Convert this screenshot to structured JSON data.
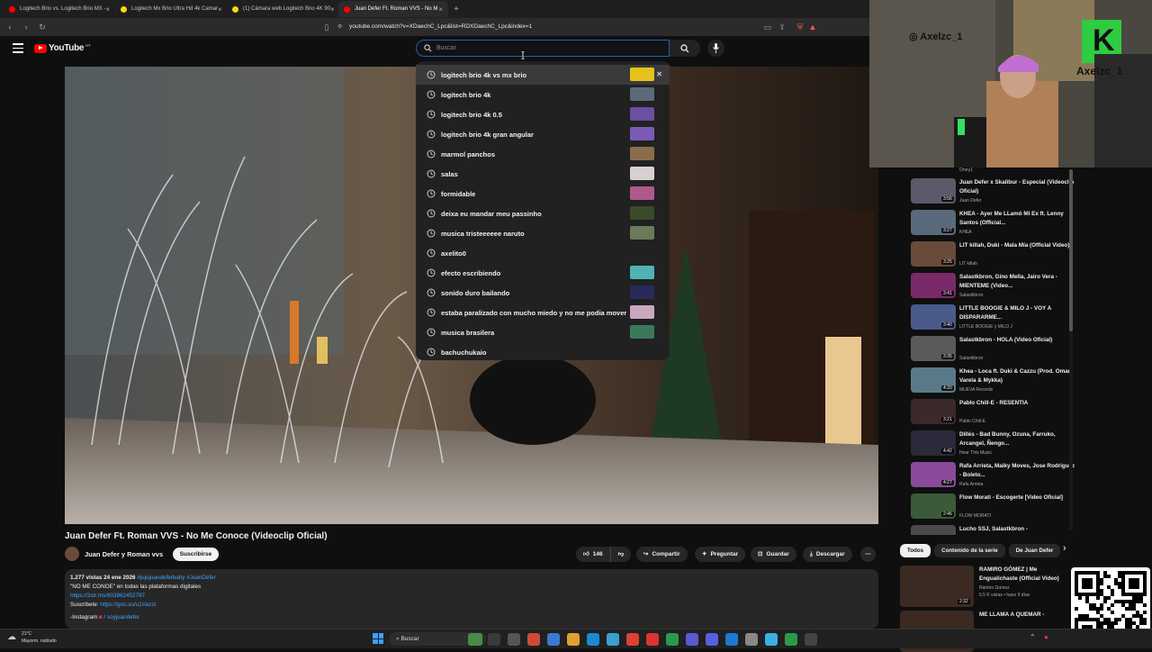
{
  "browser": {
    "tabs": [
      {
        "label": "Logitech Brio vs. Logitech Brio MX -",
        "color": "#ff0000"
      },
      {
        "label": "Logitech Mx Brio Ultra Hd 4k Camar",
        "color": "#f5d90a"
      },
      {
        "label": "(1) Cámara web Logitech Brio 4K 90",
        "color": "#f5d90a"
      },
      {
        "label": "Juan Defer Ft. Roman VVS - No M",
        "color": "#ff0000"
      }
    ],
    "new_tab": "+",
    "url": "youtube.com/watch?v=XDaechC_Lpc&list=RDXDaechC_Lpc&index=1"
  },
  "youtube": {
    "logo_text": "YouTube",
    "logo_sup": "AR",
    "search_placeholder": "Buscar",
    "suggestions": [
      {
        "text": "logitech brio 4k vs mx brio",
        "thumb": "#e6c21a",
        "remove": "✕"
      },
      {
        "text": "logitech brio 4k",
        "thumb": "#5b6a78"
      },
      {
        "text": "logitech brio 4k 0.5",
        "thumb": "#6b4fa0"
      },
      {
        "text": "logitech brio 4k gran angular",
        "thumb": "#7d5ab8"
      },
      {
        "text": "marmol panchos",
        "thumb": "#8a6d4a"
      },
      {
        "text": "salas",
        "thumb": "#d8d0d0"
      },
      {
        "text": "formidable",
        "thumb": "#b05a8c"
      },
      {
        "text": "deixa eu mandar meu passinho",
        "thumb": "#3b4a2a"
      },
      {
        "text": "musica tristeeeeee naruto",
        "thumb": "#6b7a5a"
      },
      {
        "text": "axelito0",
        "thumb": ""
      },
      {
        "text": "efecto escribiendo",
        "thumb": "#4fb3b3"
      },
      {
        "text": "sonido duro bailando",
        "thumb": "#2a2a5a"
      },
      {
        "text": "estaba paralizado con mucho miedo y no me podia mover",
        "thumb": "#c9a8c0"
      },
      {
        "text": "musica brasilera",
        "thumb": "#3a7a5a"
      },
      {
        "text": "bachuchukaio",
        "thumb": ""
      }
    ]
  },
  "video": {
    "title": "Juan Defer Ft. Roman VVS - No Me Conoce (Videoclip Oficial)",
    "channel": "Juan Defer y Roman vvs",
    "subscribe": "Suscribirse",
    "likes": "146",
    "share": "Compartir",
    "ask": "Preguntar",
    "save": "Guardar",
    "download": "Descargar",
    "more": "⋯"
  },
  "description": {
    "stats": "1.277 vistas  24 ene 2026",
    "hashtags": "#jujujuandeferbaby #JuanDefer",
    "line1": "\"NO ME CONOE\" en todas las plataformas digitales",
    "link1": "https://2str.ms/603962452797",
    "sub_label": "Suscribete:",
    "sub_link": "https://goo.su/u1Vazzt",
    "insta": "-Instagram",
    "insta_handle": "/ soyjuandefer"
  },
  "webcam": {
    "handle": "Axelzc_1",
    "logo_letter": "K",
    "logo_text": "Axelzc_1"
  },
  "recommendations": [
    {
      "title": "Juan Defer x Skalibur - Especial (Videoclip Oficial)",
      "channel": "Juan Defer",
      "duration": "3:56",
      "color": "#5a5a6a"
    },
    {
      "title": "KHEA - Ayer Me LLamó Mi Ex ft. Lenny Santos (Official...",
      "channel": "KHEA",
      "duration": "3:27",
      "color": "#5a6a7a"
    },
    {
      "title": "LIT killah, Duki - Mala Mía (Official Video)",
      "channel": "LIT killah",
      "duration": "3:25",
      "color": "#6a4a3a"
    },
    {
      "title": "Salastkbron, Gino Mella, Jairo Vera - MIENTEME (Video...",
      "channel": "Salastkbron",
      "duration": "3:41",
      "color": "#7a2a6a"
    },
    {
      "title": "LITTLE BOOGIE & MILO J - VOY A DISPARARME...",
      "channel": "LITTLE BOOGIE y MILO J",
      "duration": "3:40",
      "color": "#4a5a8a"
    },
    {
      "title": "Salastkbron - HOLA (Video Oficial)",
      "channel": "Salastkbron",
      "duration": "3:35",
      "color": "#5a5a5a"
    },
    {
      "title": "Khea - Loca ft. Duki & Cazzu (Prod. Omar Varela & Mykka)",
      "channel": "MUEVA Records",
      "duration": "4:20",
      "color": "#5a7a8a"
    },
    {
      "title": "Pablo Chill-E - RESENTIA",
      "channel": "Pablo Chill-E",
      "duration": "3:21",
      "color": "#3a2a2a"
    },
    {
      "title": "Dillés - Bad Bunny, Ozuna, Farruko, Arcangel, Ñengo...",
      "channel": "Hear This Music",
      "duration": "4:42",
      "color": "#2a2a3a"
    },
    {
      "title": "Rafa Arrieta, Maiky Moves, Jose Rodriguez - Boleto...",
      "channel": "Rafa Arrieta",
      "duration": "4:27",
      "color": "#8a4a9a"
    },
    {
      "title": "Flow Morati - Escogerte [Video Oficial]",
      "channel": "FLOW MORATI",
      "duration": "2:46",
      "color": "#3a5a3a"
    },
    {
      "title": "Lucho SSJ, Salastkbron -",
      "channel": "",
      "duration": "",
      "color": "#4a4a4a"
    }
  ],
  "sidebar_top_channel": "Oney1",
  "chips": [
    {
      "label": "Todos",
      "active": true
    },
    {
      "label": "Contenido de la serie",
      "active": false
    },
    {
      "label": "De Juan Defer",
      "active": false
    }
  ],
  "chips_next": "›",
  "bottom_recs": [
    {
      "title": "RAMIRO GÓMEZ | Me Engualichaste (Official Video)",
      "channel": "Ramiro Gomez",
      "meta": "5.5 K vistas • hace 9 días",
      "duration": "2:32"
    },
    {
      "title": "ME LLAMA A QUEMAR -",
      "channel": "",
      "meta": "",
      "duration": ""
    }
  ],
  "taskbar": {
    "weather_temp": "21°C",
    "weather_desc": "Mayorm. nublado",
    "search": "Buscar"
  }
}
